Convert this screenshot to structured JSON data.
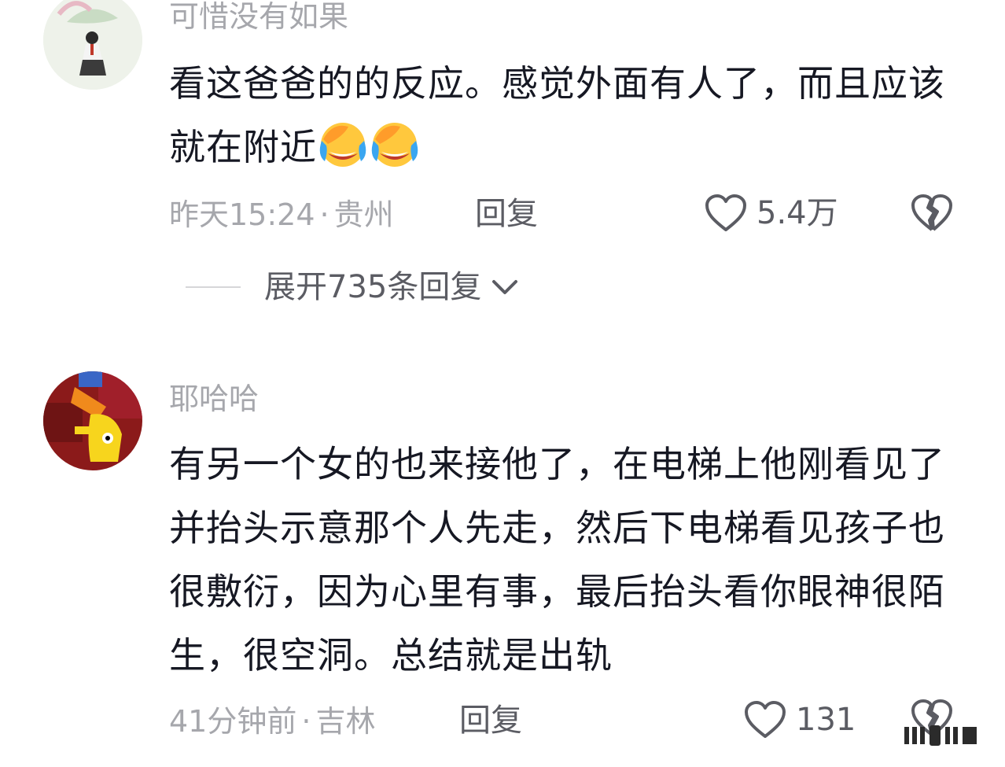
{
  "comments": [
    {
      "username": "可惜没有如果",
      "text": "看这爸爸的的反应。感觉外面有人了，而且应该就在附近",
      "emoji_count": 2,
      "emoji_icon": "laughing-crying-emoji",
      "time": "昨天15:24",
      "location": "贵州",
      "reply_label": "回复",
      "likes": "5.4万"
    },
    {
      "username": "耶哈哈",
      "text": "有另一个女的也来接他了，在电梯上他刚看见了并抬头示意那个人先走，然后下电梯看见孩子也很敷衍，因为心里有事，最后抬头看你眼神很陌生，很空洞。总结就是出轨",
      "time": "41分钟前",
      "location": "吉林",
      "reply_label": "回复",
      "likes": "131"
    }
  ],
  "expand_replies": {
    "label": "展开735条回复"
  },
  "separator": "·",
  "colors": {
    "text_primary": "#161823",
    "text_secondary": "#a6a7ac",
    "text_action": "#5b5c63",
    "emoji_yellow": "#ffc83d",
    "emoji_tear": "#3aa6f0"
  }
}
